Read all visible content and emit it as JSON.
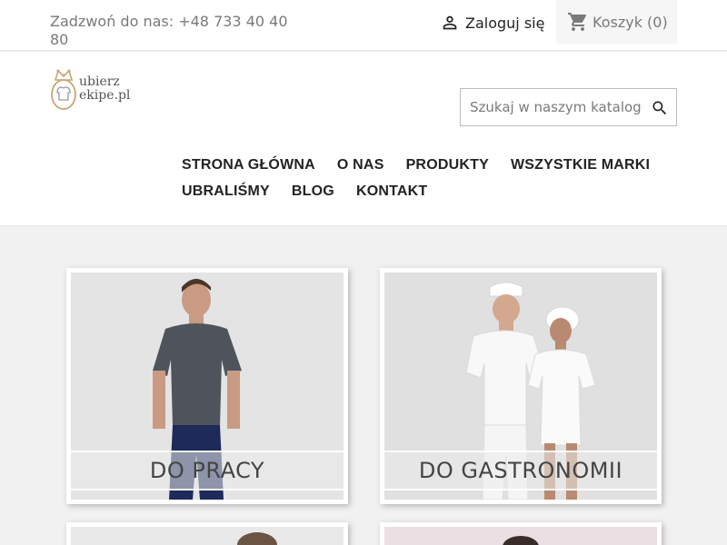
{
  "topbar": {
    "phone": "Zadzwoń do nas: +48 733 40 40 80",
    "login_label": "Zaloguj się",
    "cart_label": "Koszyk",
    "cart_count": "(0)"
  },
  "logo": {
    "line1": "ubierz",
    "line2": "ekipe.pl"
  },
  "search": {
    "placeholder": "Szukaj w naszym katalogu"
  },
  "nav": {
    "items": [
      "STRONA GŁÓWNA",
      "O NAS",
      "PRODUKTY",
      "WSZYSTKIE MARKI",
      "UBRALIŚMY",
      "BLOG",
      "KONTAKT"
    ]
  },
  "categories": [
    {
      "label": "DO PRACY"
    },
    {
      "label": "DO GASTRONOMII"
    }
  ]
}
